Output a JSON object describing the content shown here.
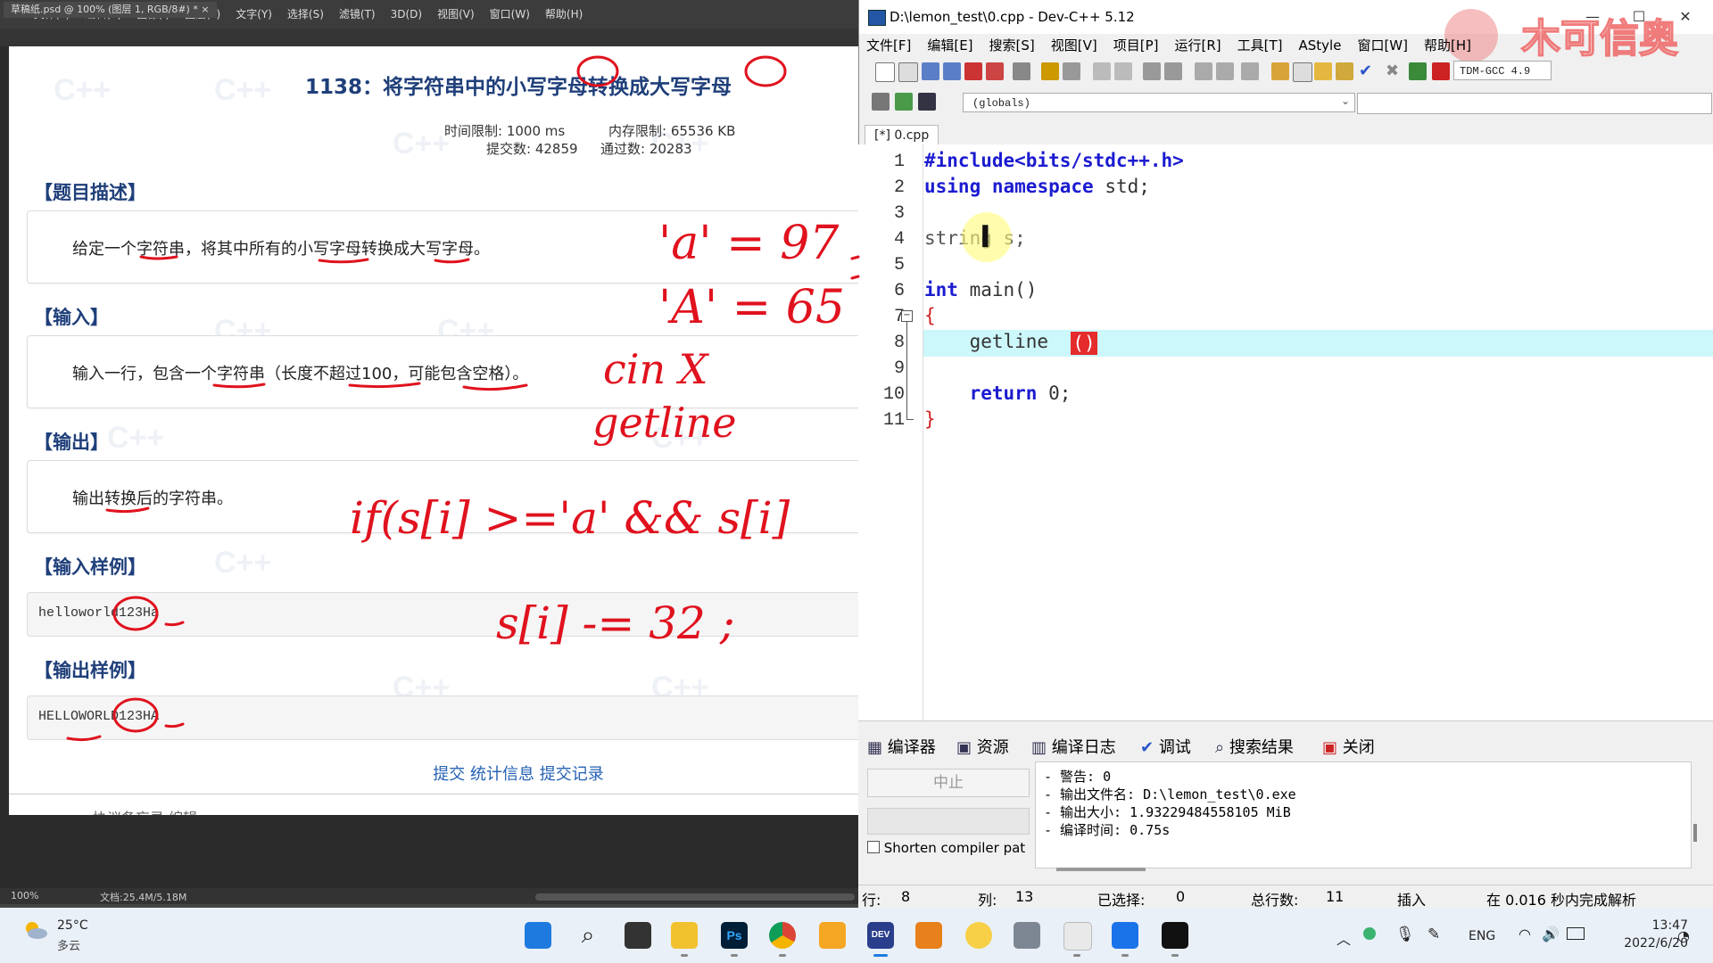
{
  "photoshop": {
    "menu": [
      "文件(F)",
      "编辑(E)",
      "图像(I)",
      "图层(L)",
      "文字(Y)",
      "选择(S)",
      "滤镜(T)",
      "3D(D)",
      "视图(V)",
      "窗口(W)",
      "帮助(H)"
    ],
    "doc_tab": "草稿纸.psd @ 100% (图层 1, RGB/8#) *  ×",
    "status_zoom": "100%",
    "status_doc": "文档:25.4M/5.18M"
  },
  "problem": {
    "title": "1138：将字符串中的小写字母转换成大写字母",
    "time_limit": "时间限制: 1000 ms",
    "mem_limit": "内存限制: 65536 KB",
    "submits": "提交数: 42859",
    "passes": "通过数: 20283",
    "desc_h": "【题目描述】",
    "desc": "给定一个字符串，将其中所有的小写字母转换成大写字母。",
    "input_h": "【输入】",
    "input": "输入一行，包含一个字符串（长度不超过100，可能包含空格）。",
    "output_h": "【输出】",
    "output": "输出转换后的字符串。",
    "sample_in_h": "【输入样例】",
    "sample_in": "helloworld123Ha",
    "sample_out_h": "【输出样例】",
    "sample_out": "HELLOWORLD123HA",
    "links": "提交 统计信息 提交记录",
    "footer_cut": "协议备忘录   编辑"
  },
  "annotations": {
    "a97": "'a' = 97",
    "A65": "'A' = 65",
    "cin": "cin  X",
    "getline": "getline",
    "if_line": "if(s[i] >='a'  &&  s[i]",
    "minus32": "s[i]  -= 32 ;"
  },
  "devcpp": {
    "title": "D:\\lemon_test\\0.cpp - Dev-C++ 5.12",
    "menu": [
      "文件[F]",
      "编辑[E]",
      "搜索[S]",
      "视图[V]",
      "项目[P]",
      "运行[R]",
      "工具[T]",
      "AStyle",
      "窗口[W]",
      "帮助[H]"
    ],
    "compiler_select": "TDM-GCC 4.9",
    "scope": "(globals)",
    "file_tab": "[*] 0.cpp",
    "line_numbers": [
      "1",
      "2",
      "3",
      "4",
      "5",
      "6",
      "7",
      "8",
      "9",
      "10",
      "11"
    ],
    "code": {
      "l1": "#include<bits/stdc++.h>",
      "l2_kw1": "using",
      "l2_kw2": "namespace",
      "l2_rest": " std;",
      "l4": "string s;",
      "l6_kw": "int",
      "l6_rest": " main()",
      "l7": "{",
      "l8": "    getline",
      "l8_paren": "()",
      "l10_kw": "    return",
      "l10_rest": " 0;",
      "l11": "}"
    },
    "bottom_tabs": [
      "编译器",
      "资源",
      "编译日志",
      "调试",
      "搜索结果",
      "关闭"
    ],
    "stop_button": "中止",
    "shorten_label": "Shorten compiler pat",
    "log": [
      "- 警告: 0",
      "- 输出文件名: D:\\lemon_test\\0.exe",
      "- 输出大小: 1.93229484558105 MiB",
      "- 编译时间: 0.75s"
    ],
    "status": {
      "row_label": "行:",
      "row": "8",
      "col_label": "列:",
      "col": "13",
      "sel_label": "已选择:",
      "sel": "0",
      "total_label": "总行数:",
      "total": "11",
      "mode": "插入",
      "parse": "在 0.016 秒内完成解析"
    },
    "watermark": "木可信奥"
  },
  "taskbar": {
    "temp": "25°C",
    "condition": "多云",
    "lang": "ENG",
    "time": "13:47",
    "date": "2022/6/20"
  },
  "colors": {
    "ps_bg": "#3c3c3c",
    "ps_blue": "#31a8ff",
    "title_blue": "#1f3f7a",
    "annotation_red": "#e0121e",
    "keyword_blue": "#1b1bd0",
    "current_line": "#ccf7fb"
  }
}
